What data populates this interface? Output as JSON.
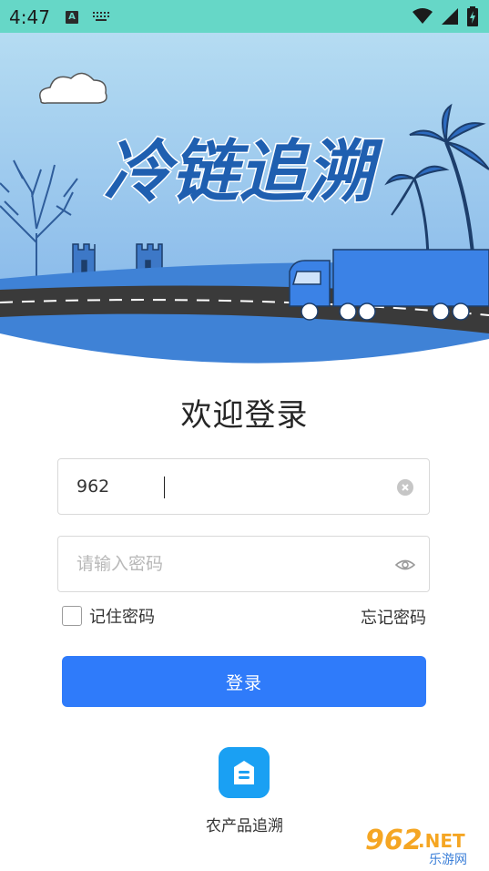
{
  "status_bar": {
    "time": "4:47",
    "notification_letter": "A"
  },
  "banner": {
    "title": "冷链追溯"
  },
  "login": {
    "welcome_title": "欢迎登录",
    "username_value": "962",
    "password_placeholder": "请输入密码",
    "remember_label": "记住密码",
    "forgot_label": "忘记密码",
    "login_button_label": "登录"
  },
  "shortcut": {
    "label": "农产品追溯"
  },
  "watermark": {
    "brand": "962",
    "domain": ".NET",
    "site_name": "乐游网"
  },
  "colors": {
    "status_bar": "#66d7c7",
    "primary": "#2f7bfa",
    "app_icon": "#1aa0f3",
    "banner_sky": "#9cc8ee"
  }
}
